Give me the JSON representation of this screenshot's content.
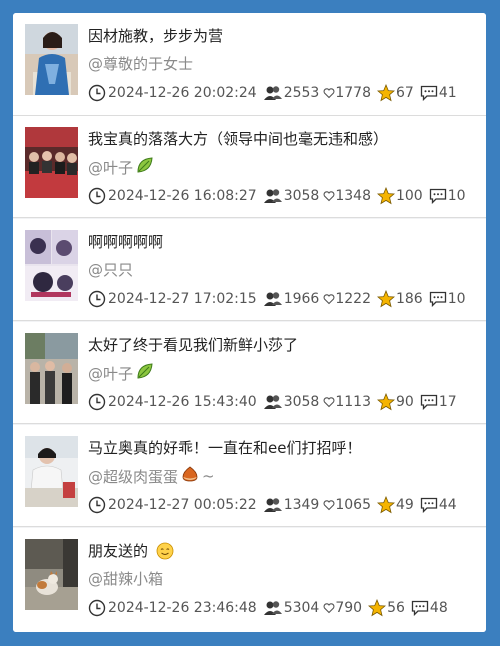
{
  "posts": [
    {
      "title": "因材施教，步步为营",
      "author": "@尊敬的于女士",
      "author_badge": "",
      "author_suffix": "",
      "time": "2024-12-26 20:02:24",
      "views": "2553",
      "likes": "1778",
      "favorites": "67",
      "comments": "41",
      "title_emoji": "",
      "thumb": "woman-in-blue-dress"
    },
    {
      "title": "我宝真的落落大方（领导中间也毫无违和感）",
      "author": "@叶子",
      "author_badge": "leaf-icon",
      "author_suffix": "",
      "time": "2024-12-26 16:08:27",
      "views": "3058",
      "likes": "1348",
      "favorites": "100",
      "comments": "10",
      "title_emoji": "",
      "thumb": "event-crowd"
    },
    {
      "title": "啊啊啊啊啊",
      "author": "@只只",
      "author_badge": "",
      "author_suffix": "",
      "time": "2024-12-27 17:02:15",
      "views": "1966",
      "likes": "1222",
      "favorites": "186",
      "comments": "10",
      "title_emoji": "",
      "thumb": "anime-collage"
    },
    {
      "title": "太好了终于看见我们新鲜小莎了",
      "author": "@叶子",
      "author_badge": "leaf-icon",
      "author_suffix": "",
      "time": "2024-12-26 15:43:40",
      "views": "3058",
      "likes": "1113",
      "favorites": "90",
      "comments": "17",
      "title_emoji": "",
      "thumb": "people-indoor"
    },
    {
      "title": "马立奥真的好乖！一直在和ee们打招呼！",
      "author": "@超级肉蛋蛋",
      "author_badge": "chestnut-icon",
      "author_suffix": "~",
      "time": "2024-12-27 00:05:22",
      "views": "1349",
      "likes": "1065",
      "favorites": "49",
      "comments": "44",
      "title_emoji": "",
      "thumb": "person-at-desk"
    },
    {
      "title": "朋友送的",
      "author": "@甜辣小箱",
      "author_badge": "",
      "author_suffix": "",
      "time": "2024-12-26 23:46:48",
      "views": "5304",
      "likes": "790",
      "favorites": "56",
      "comments": "48",
      "title_emoji": "smiling-face-emoji",
      "thumb": "cat-photo"
    }
  ],
  "colors": {
    "frame": "#3b7fbf",
    "star": "#f5b400",
    "text": "#222222",
    "muted": "#8a8a8a"
  }
}
